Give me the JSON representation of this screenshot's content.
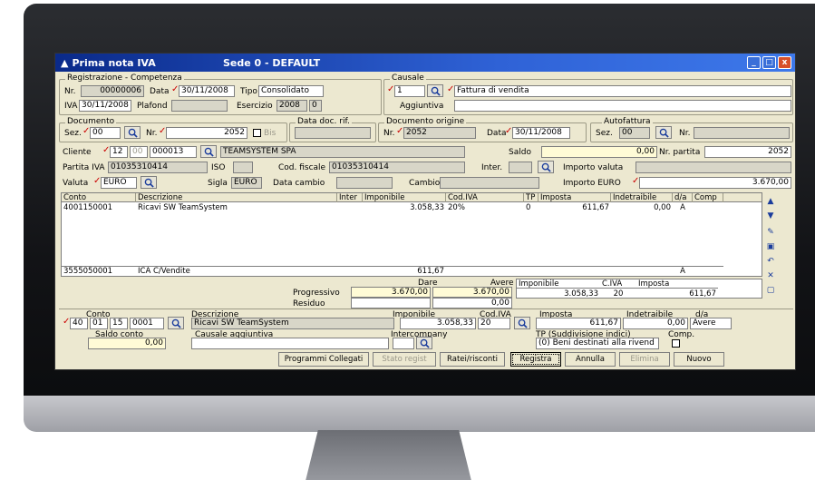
{
  "window": {
    "title": "Prima nota IVA",
    "sede": "Sede 0 - DEFAULT",
    "controls": [
      "_",
      "□",
      "x"
    ]
  },
  "registrazione": {
    "legend": "Registrazione - Competenza",
    "nr_label": "Nr.",
    "nr": "00000006",
    "data_label": "Data",
    "data": "30/11/2008",
    "tipo_label": "Tipo",
    "tipo": "Consolidato",
    "iva_label": "IVA",
    "iva": "30/11/2008",
    "plafond_label": "Plafond",
    "esercizio_label": "Esercizio",
    "esercizio": "2008",
    "esercizio_extra": "0"
  },
  "causale": {
    "legend": "Causale",
    "code": "1",
    "desc": "Fattura di vendita",
    "aggiuntiva_label": "Aggiuntiva"
  },
  "documento": {
    "legend": "Documento",
    "sez_label": "Sez.",
    "sez": "00",
    "nr_label": "Nr.",
    "nr": "2052",
    "bis_label": "Bis",
    "data_rif_legend": "Data doc. rif."
  },
  "documento_origine": {
    "legend": "Documento origine",
    "nr_label": "Nr.",
    "nr": "2052",
    "data_label": "Data",
    "data": "30/11/2008"
  },
  "autofattura": {
    "legend": "Autofattura",
    "sez_label": "Sez.",
    "sez": "00",
    "nr_label": "Nr."
  },
  "cliente": {
    "label": "Cliente",
    "c1": "12",
    "c2": "00",
    "c3": "000013",
    "name": "TEAMSYSTEM SPA",
    "saldo_label": "Saldo",
    "saldo": "0,00",
    "nr_partita_label": "Nr. partita",
    "nr_partita": "2052"
  },
  "fiscale": {
    "piva_label": "Partita IVA",
    "piva": "01035310414",
    "iso_label": "ISO",
    "cf_label": "Cod. fiscale",
    "cf": "01035310414",
    "inter_label": "Inter.",
    "importo_valuta_label": "Importo valuta"
  },
  "valuta": {
    "label": "Valuta",
    "code": "EURO",
    "sigla_label": "Sigla",
    "sigla": "EURO",
    "data_cambio_label": "Data cambio",
    "cambio_label": "Cambio",
    "importo_euro_label": "Importo EURO",
    "importo_euro": "3.670,00"
  },
  "grid": {
    "headers": [
      "Conto",
      "Descrizione",
      "Inter",
      "Imponibile",
      "Cod.IVA",
      "TP",
      "Imposta",
      "Indetraibile",
      "d/a",
      "Comp"
    ],
    "rows": [
      [
        "4001150001",
        "Ricavi SW TeamSystem",
        "",
        "3.058,33",
        "20%",
        "0",
        "611,67",
        "0,00",
        "A",
        ""
      ],
      [
        "3555050001",
        "ICA C/Vendite",
        "",
        "611,67",
        "",
        "",
        "",
        "",
        "A",
        ""
      ]
    ]
  },
  "totali": {
    "dare_label": "Dare",
    "avere_label": "Avere",
    "progressivo_label": "Progressivo",
    "residuo_label": "Residuo",
    "prog_dare": "3.670,00",
    "prog_avere": "3.670,00",
    "residuo_avere": "0,00",
    "imponibile_label": "Imponibile",
    "civa_label": "C.IVA",
    "imposta_label": "Imposta",
    "imponibile": "3.058,33",
    "civa": "20",
    "imposta": "611,67"
  },
  "dettaglio": {
    "conto_label": "Conto",
    "c1": "40",
    "c2": "01",
    "c3": "15",
    "c4": "0001",
    "descr_label": "Descrizione",
    "descr": "Ricavi SW TeamSystem",
    "imponibile_label": "Imponibile",
    "imponibile": "3.058,33",
    "codiva_label": "Cod.IVA",
    "codiva": "20",
    "imposta_label": "Imposta",
    "imposta": "611,67",
    "indetraibile_label": "Indetraibile",
    "indetraibile": "0,00",
    "da_label": "d/a",
    "da": "Avere",
    "saldo_conto_label": "Saldo conto",
    "saldo_conto": "0,00",
    "causale_agg_label": "Causale aggiuntiva",
    "intercompany_label": "Intercompany",
    "tp_label": "TP (Suddivisione indici)",
    "tp": "(0) Beni destinati alla rivend",
    "comp_label": "Comp."
  },
  "buttons": [
    "Programmi Collegati",
    "Stato regist",
    "Ratei/risconti",
    "Registra",
    "Annulla",
    "Elimina",
    "Nuovo"
  ]
}
